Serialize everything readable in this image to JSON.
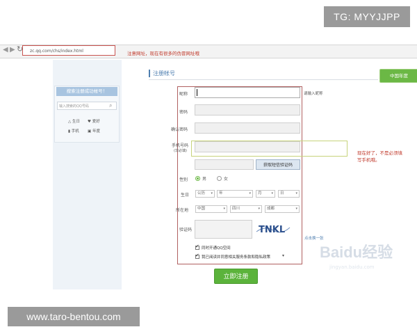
{
  "watermarks": {
    "top": "TG: MYYJJPP",
    "bottom": "www.taro-bentou.com"
  },
  "browser": {
    "back_icon": "arrow-left-icon",
    "forward_icon": "arrow-right-icon",
    "reload_icon": "reload-icon",
    "url": "zc.qq.com/chs/index.html",
    "url_note": "注意网址，现在有很多的伪冒网址哦"
  },
  "left_panel": {
    "title": "搜索注册成功帐号！",
    "search_placeholder": "输入搜索的QQ号码",
    "links": [
      "生日",
      "爱好",
      "手机",
      "年度"
    ]
  },
  "page": {
    "section_title": "注册帐号",
    "badge": "中国年度"
  },
  "form": {
    "nickname_label": "昵称",
    "nickname_hint": "请输入昵称",
    "password_label": "密码",
    "confirm_label": "确认密码",
    "phone_label": "手机号码",
    "phone_sub": "(非必填)",
    "phone_note": [
      "现在好了，不是必须填",
      "写手机哦。"
    ],
    "sms_button": "获取短信验证码",
    "gender_label": "性别",
    "gender_options": [
      "男",
      "女"
    ],
    "birthday_label": "生日",
    "birthday_selects": [
      "公历",
      "年",
      "月",
      "日"
    ],
    "location_label": "所在地",
    "location_selects": [
      "中国",
      "四川",
      "成都"
    ],
    "captcha_label": "验证码",
    "captcha_text": "TNKL",
    "refresh_link": "点击换一张",
    "check_space": "同时开通QQ空间",
    "check_terms": "我已阅读并同意相关服务条款和隐私政策",
    "submit": "立即注册"
  },
  "baidu_watermark": {
    "logo": "Baidu经验",
    "sub": "jingyan.baidu.com"
  },
  "colors": {
    "accent_green": "#5bb33b",
    "note_red": "#c0392b",
    "link_blue": "#4f7fb0"
  }
}
